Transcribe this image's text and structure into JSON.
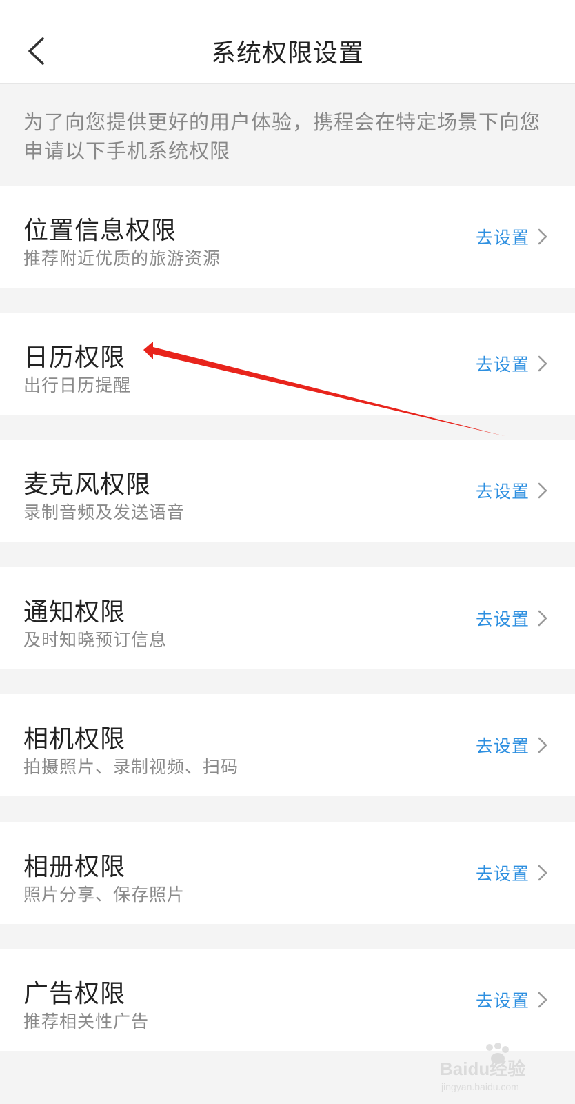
{
  "header": {
    "title": "系统权限设置"
  },
  "intro": {
    "text": "为了向您提供更好的用户体验，携程会在特定场景下向您申请以下手机系统权限"
  },
  "permissions": [
    {
      "title": "位置信息权限",
      "desc": "推荐附近优质的旅游资源",
      "action": "去设置"
    },
    {
      "title": "日历权限",
      "desc": "出行日历提醒",
      "action": "去设置"
    },
    {
      "title": "麦克风权限",
      "desc": "录制音频及发送语音",
      "action": "去设置"
    },
    {
      "title": "通知权限",
      "desc": "及时知晓预订信息",
      "action": "去设置"
    },
    {
      "title": "相机权限",
      "desc": "拍摄照片、录制视频、扫码",
      "action": "去设置"
    },
    {
      "title": "相册权限",
      "desc": "照片分享、保存照片",
      "action": "去设置"
    },
    {
      "title": "广告权限",
      "desc": "推荐相关性广告",
      "action": "去设置"
    }
  ],
  "watermark": {
    "brand": "Baidu经验",
    "url": "jingyan.baidu.com"
  },
  "colors": {
    "action_blue": "#2d8fe0",
    "annotation_red": "#e8241c",
    "background_gray": "#f4f4f4"
  }
}
